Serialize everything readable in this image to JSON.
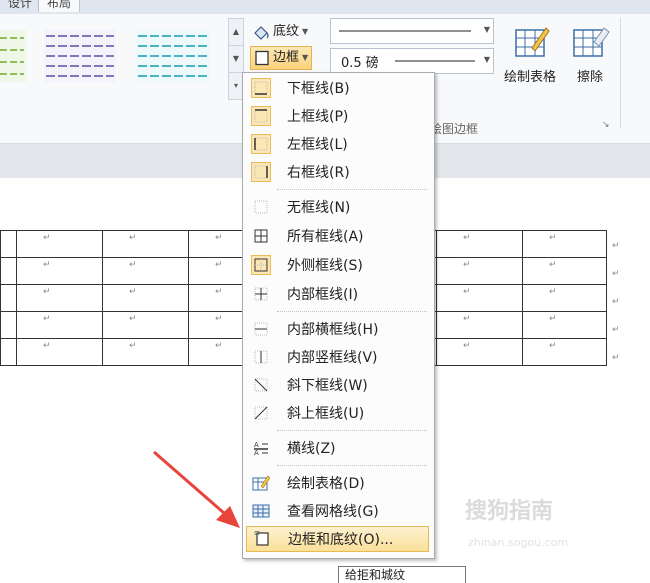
{
  "tabs": [
    "设计",
    "布局"
  ],
  "shading_label": "底纹",
  "border_label": "边框",
  "pen_weight": "0.5 磅",
  "draw_table_label": "绘制表格",
  "eraser_label": "擦除",
  "draw_border_group": "绘图边框",
  "menu": {
    "items": [
      {
        "label": "下框线(B)",
        "icon": "bottom-border-icon"
      },
      {
        "label": "上框线(P)",
        "icon": "top-border-icon"
      },
      {
        "label": "左框线(L)",
        "icon": "left-border-icon"
      },
      {
        "label": "右框线(R)",
        "icon": "right-border-icon"
      },
      {
        "label": "无框线(N)",
        "icon": "no-border-icon"
      },
      {
        "label": "所有框线(A)",
        "icon": "all-borders-icon"
      },
      {
        "label": "外侧框线(S)",
        "icon": "outside-borders-icon"
      },
      {
        "label": "内部框线(I)",
        "icon": "inside-borders-icon"
      },
      {
        "label": "内部横框线(H)",
        "icon": "inside-horizontal-border-icon"
      },
      {
        "label": "内部竖框线(V)",
        "icon": "inside-vertical-border-icon"
      },
      {
        "label": "斜下框线(W)",
        "icon": "diagonal-down-border-icon"
      },
      {
        "label": "斜上框线(U)",
        "icon": "diagonal-up-border-icon"
      },
      {
        "label": "横线(Z)",
        "icon": "horizontal-line-icon"
      },
      {
        "label": "绘制表格(D)",
        "icon": "draw-table-icon"
      },
      {
        "label": "查看网格线(G)",
        "icon": "view-gridlines-icon"
      },
      {
        "label": "边框和底纹(O)...",
        "icon": "borders-shading-icon"
      }
    ]
  },
  "cell_mark": "↵",
  "watermark": "搜狗指南",
  "watermark_url": "zhinan.sogou.com",
  "bottom_partial_text": "给拒和城纹",
  "colors": {
    "accent": "#f9d27a",
    "arrow": "#e8443a"
  }
}
